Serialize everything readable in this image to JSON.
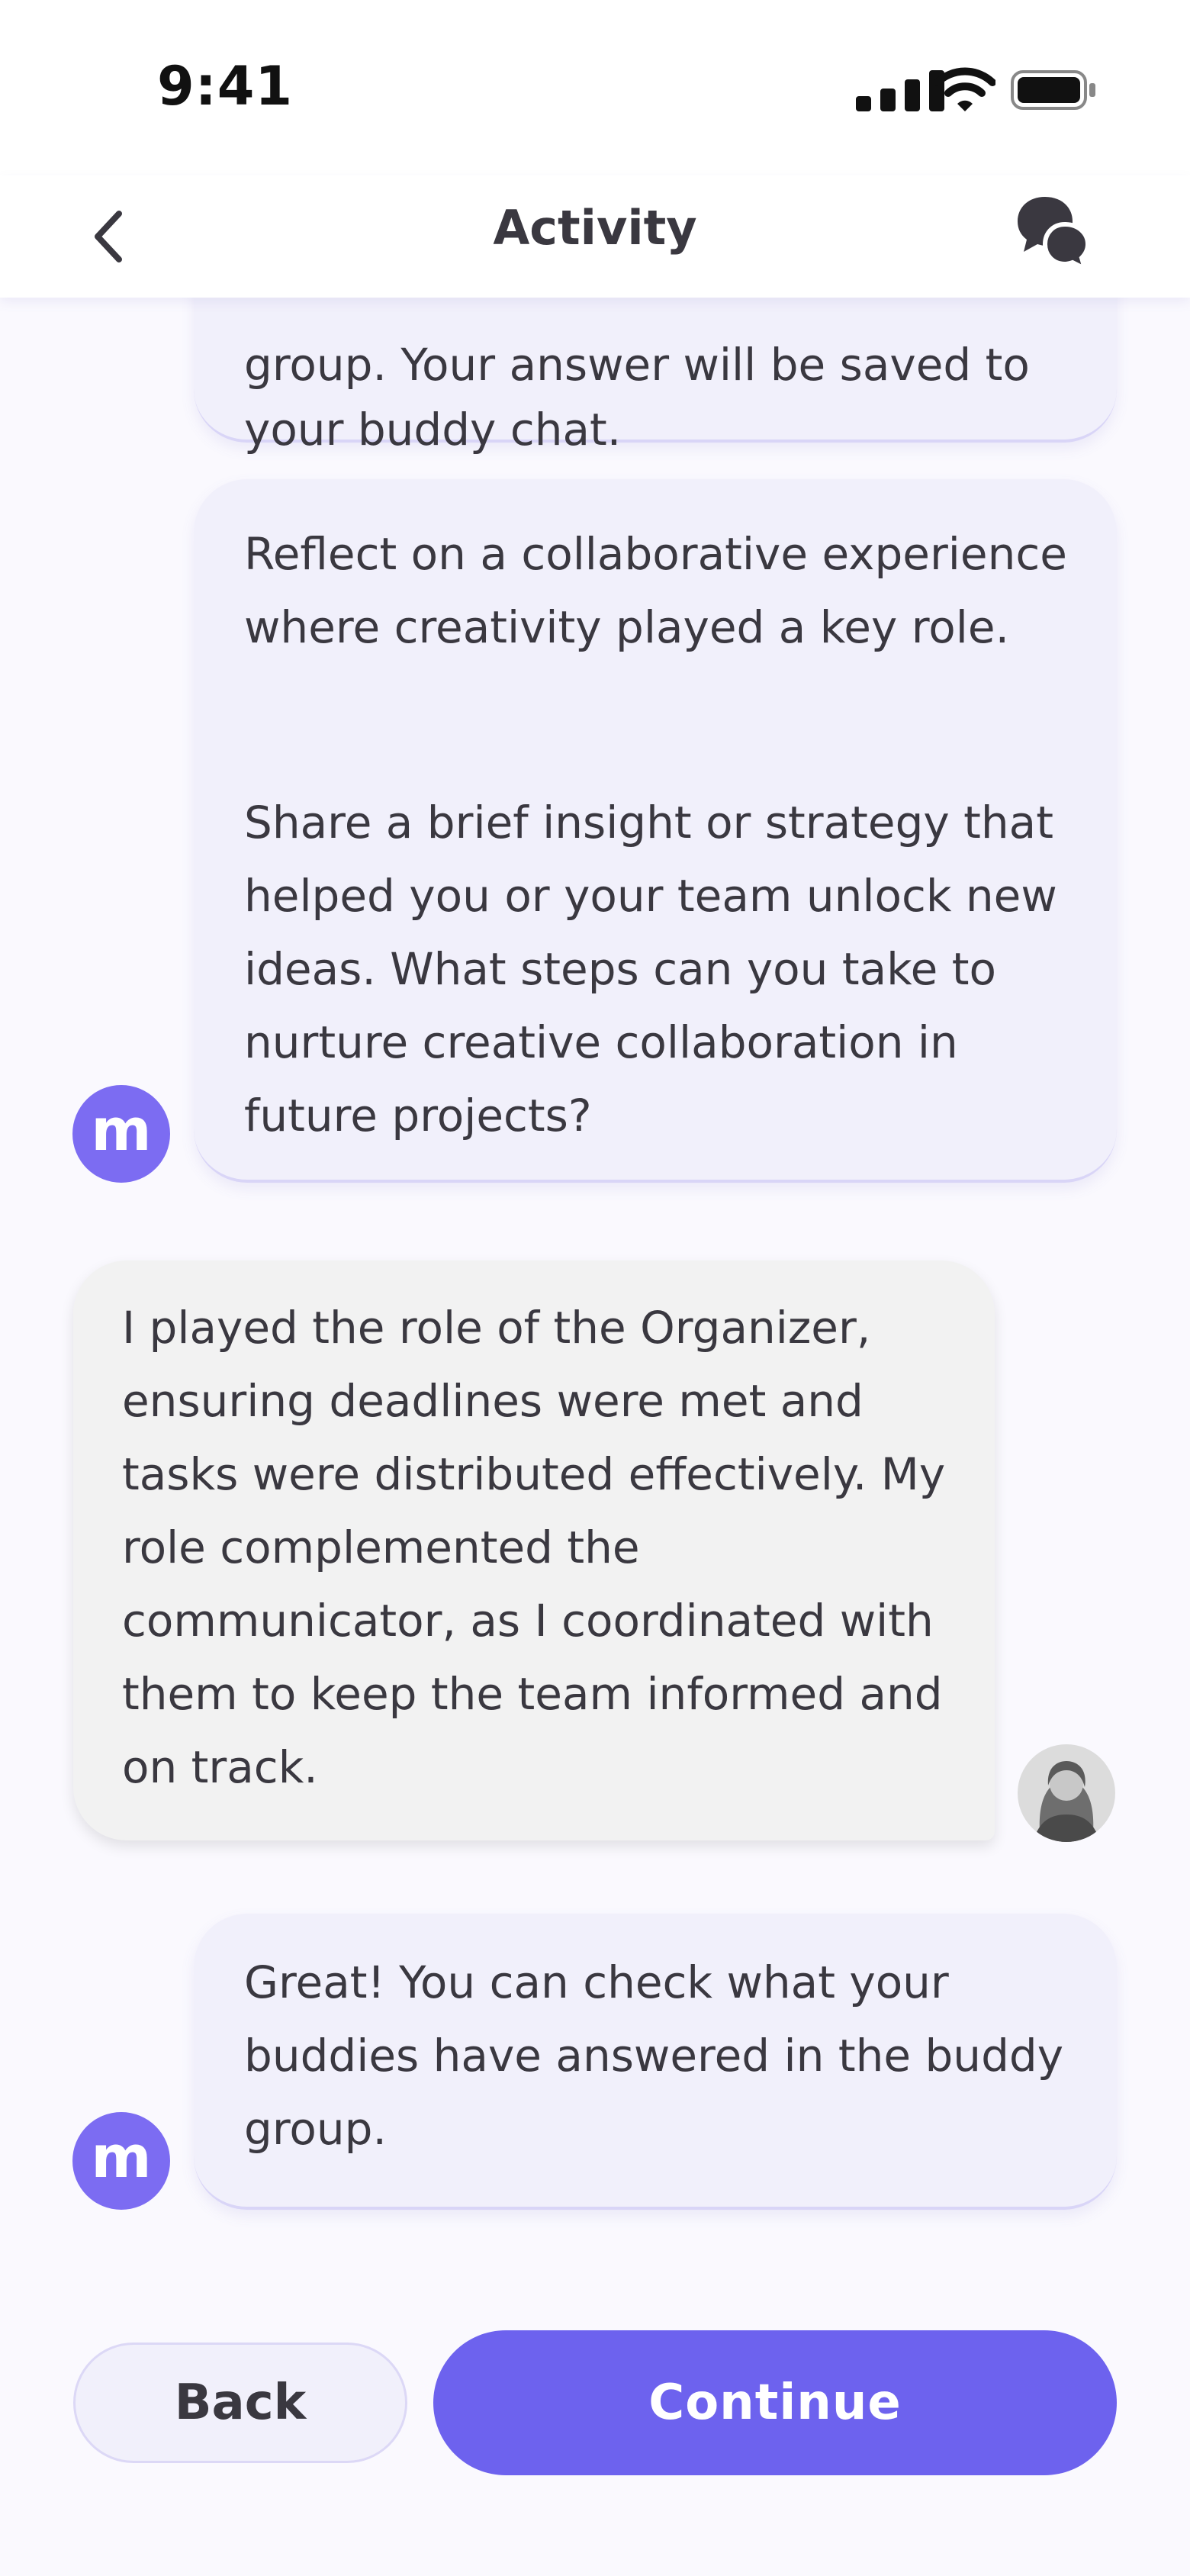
{
  "status_bar": {
    "time": "9:41"
  },
  "header": {
    "title": "Activity",
    "back_icon": "chevron-left-icon",
    "chat_icon": "chat-bubbles-icon"
  },
  "messages": [
    {
      "sender": "bot",
      "lines": [
        "group. Your answer will be saved to",
        "your buddy chat."
      ]
    },
    {
      "sender": "bot",
      "paragraphs": [
        "Reflect on a collaborative experience where creativity played a key role.",
        "Share a brief insight or strategy that helped you or your team unlock new ideas. What steps can you take to nurture creative collaboration in future projects?"
      ]
    },
    {
      "sender": "user",
      "text": "I played the role of the Organizer, ensuring deadlines were met and tasks were distributed effectively. My role complemented the communicator, as I coordinated with them to keep the team informed and on track."
    },
    {
      "sender": "bot",
      "text": "Great! You can check what your buddies have answered in the buddy group."
    }
  ],
  "bot_avatar_letter": "m",
  "buttons": {
    "back": "Back",
    "continue": "Continue"
  },
  "colors": {
    "accent": "#6D62EE",
    "bot_bubble": "#F1F0FB",
    "user_bubble": "#F2F2F2"
  }
}
